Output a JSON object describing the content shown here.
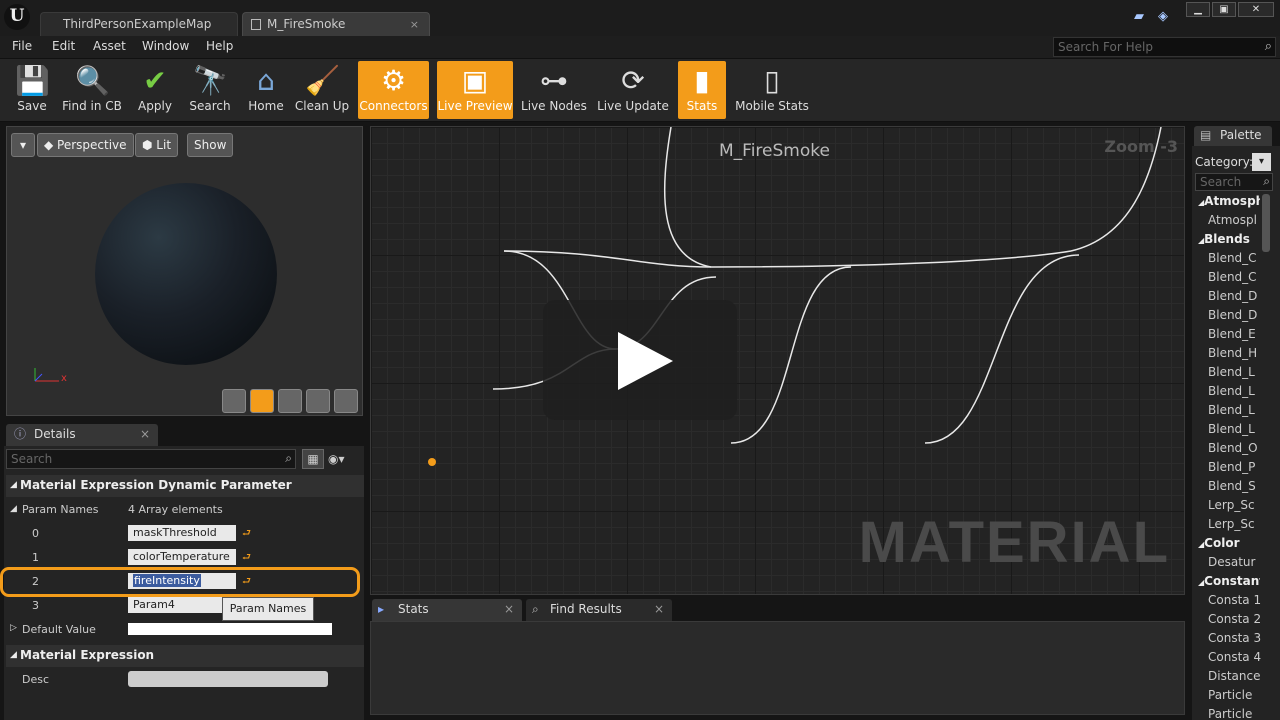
{
  "titlebar": {
    "tabs": [
      {
        "label": "ThirdPersonExampleMap"
      },
      {
        "label": "M_FireSmoke"
      }
    ],
    "close_glyph": "×"
  },
  "menubar": {
    "items": [
      "File",
      "Edit",
      "Asset",
      "Window",
      "Help"
    ],
    "search_placeholder": "Search For Help"
  },
  "toolbar": {
    "buttons": [
      {
        "label": "Save",
        "icon": "save-icon",
        "active": false
      },
      {
        "label": "Find in CB",
        "icon": "find-in-content-browser-icon",
        "active": false
      },
      {
        "label": "Apply",
        "icon": "apply-checkmark-icon",
        "active": false
      },
      {
        "label": "Search",
        "icon": "search-icon",
        "active": false
      },
      {
        "label": "Home",
        "icon": "home-icon",
        "active": false
      },
      {
        "label": "Clean Up",
        "icon": "clean-up-icon",
        "active": false
      },
      {
        "label": "Connectors",
        "icon": "connectors-icon",
        "active": true
      },
      {
        "label": "Live Preview",
        "icon": "live-preview-icon",
        "active": true
      },
      {
        "label": "Live Nodes",
        "icon": "live-nodes-icon",
        "active": false
      },
      {
        "label": "Live Update",
        "icon": "live-update-icon",
        "active": false
      },
      {
        "label": "Stats",
        "icon": "stats-icon",
        "active": true
      },
      {
        "label": "Mobile Stats",
        "icon": "mobile-stats-icon",
        "active": false
      }
    ],
    "accent_color": "#f39c1a"
  },
  "viewport": {
    "buttons": [
      "Perspective",
      "Lit",
      "Show"
    ],
    "axis_label": "x"
  },
  "details": {
    "tab_label": "Details",
    "search_placeholder": "Search",
    "section1": "Material Expression Dynamic Parameter",
    "param_names_label": "Param Names",
    "param_names_count": "4 Array elements",
    "rows": [
      {
        "index": "0",
        "value": "maskThreshold"
      },
      {
        "index": "1",
        "value": "colorTemperature"
      },
      {
        "index": "2",
        "value": "fireIntensity"
      },
      {
        "index": "3",
        "value": "Param4"
      }
    ],
    "tooltip": "Param Names",
    "default_value_label": "Default Value",
    "section2": "Material Expression",
    "desc_label": "Desc"
  },
  "graph": {
    "title": "M_FireSmoke",
    "zoom": "Zoom -3",
    "watermark": "MATERIAL"
  },
  "bottom": {
    "stats_tab": "Stats",
    "find_tab": "Find Results"
  },
  "palette": {
    "tab_label": "Palette",
    "category_label": "Category:",
    "search_placeholder": "Search",
    "entries": [
      {
        "text": "Atmosphe",
        "cat": true
      },
      {
        "text": "Atmospl",
        "cat": false
      },
      {
        "text": "Blends",
        "cat": true
      },
      {
        "text": "Blend_C",
        "cat": false
      },
      {
        "text": "Blend_C",
        "cat": false
      },
      {
        "text": "Blend_D",
        "cat": false
      },
      {
        "text": "Blend_D",
        "cat": false
      },
      {
        "text": "Blend_E",
        "cat": false
      },
      {
        "text": "Blend_H",
        "cat": false
      },
      {
        "text": "Blend_L",
        "cat": false
      },
      {
        "text": "Blend_L",
        "cat": false
      },
      {
        "text": "Blend_L",
        "cat": false
      },
      {
        "text": "Blend_L",
        "cat": false
      },
      {
        "text": "Blend_O",
        "cat": false
      },
      {
        "text": "Blend_P",
        "cat": false
      },
      {
        "text": "Blend_S",
        "cat": false
      },
      {
        "text": "Lerp_Sc",
        "cat": false
      },
      {
        "text": "Lerp_Sc",
        "cat": false
      },
      {
        "text": "Color",
        "cat": true
      },
      {
        "text": "Desatur",
        "cat": false
      },
      {
        "text": "Constants",
        "cat": true
      },
      {
        "text": "Consta 1",
        "cat": false
      },
      {
        "text": "Consta 2",
        "cat": false
      },
      {
        "text": "Consta 3",
        "cat": false
      },
      {
        "text": "Consta 4",
        "cat": false
      },
      {
        "text": "Distance",
        "cat": false
      },
      {
        "text": "Particle",
        "cat": false
      },
      {
        "text": "Particle",
        "cat": false
      }
    ]
  }
}
